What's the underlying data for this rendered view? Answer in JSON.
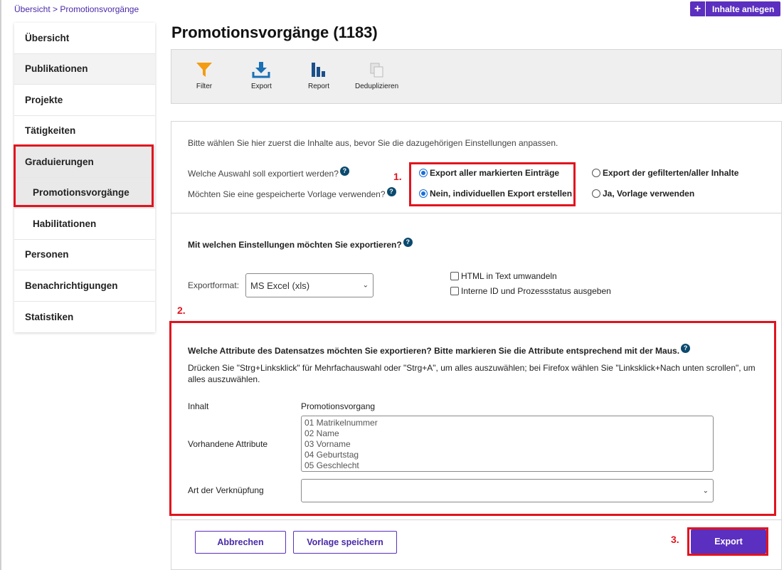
{
  "breadcrumb": {
    "home": "Übersicht",
    "separator": ">",
    "current": "Promotionsvorgänge"
  },
  "header": {
    "add_button_plus": "+",
    "add_button_label": "Inhalte anlegen"
  },
  "sidebar": {
    "items": [
      {
        "label": "Übersicht"
      },
      {
        "label": "Publikationen"
      },
      {
        "label": "Projekte"
      },
      {
        "label": "Tätigkeiten"
      },
      {
        "label": "Graduierungen"
      },
      {
        "label": "Promotionsvorgänge"
      },
      {
        "label": "Habilitationen"
      },
      {
        "label": "Personen"
      },
      {
        "label": "Benachrichtigungen"
      },
      {
        "label": "Statistiken"
      }
    ]
  },
  "page": {
    "title": "Promotionsvorgänge (1183)"
  },
  "toolbar": {
    "filter": "Filter",
    "export": "Export",
    "report": "Report",
    "dedup": "Deduplizieren"
  },
  "section1": {
    "intro": "Bitte wählen Sie hier zuerst die Inhalte aus, bevor Sie die dazugehörigen Einstellungen anpassen.",
    "q1": "Welche Auswahl soll exportiert werden?",
    "q2": "Möchten Sie eine gespeicherte Vorlage verwenden?",
    "opt_marked": "Export aller markierten Einträge",
    "opt_filtered": "Export der gefilterten/aller Inhalte",
    "opt_individual": "Nein, individuellen Export erstellen",
    "opt_template": "Ja, Vorlage verwenden",
    "step1": "1."
  },
  "section2": {
    "heading": "Mit welchen Einstellungen möchten Sie exportieren?",
    "format_label": "Exportformat:",
    "format_value": "MS Excel (xls)",
    "html_option": "HTML in Text umwandeln",
    "ids_option": "Interne ID und Prozessstatus ausgeben",
    "step2": "2."
  },
  "section3": {
    "heading": "Welche Attribute des Datensatzes möchten Sie exportieren? Bitte markieren Sie die Attribute entsprechend mit der Maus.",
    "hint": "Drücken Sie \"Strg+Linksklick\" für Mehrfachauswahl oder \"Strg+A\", um alles auszuwählen; bei Firefox wählen Sie \"Linksklick+Nach unten scrollen\", um alles auszuwählen.",
    "content_label": "Inhalt",
    "content_value": "Promotionsvorgang",
    "attributes_label": "Vorhandene Attribute",
    "attributes": [
      "01 Matrikelnummer",
      "02 Name",
      "03 Vorname",
      "04 Geburtstag",
      "05 Geschlecht"
    ],
    "link_label": "Art der Verknüpfung",
    "link_value": ""
  },
  "actions": {
    "cancel": "Abbrechen",
    "save_template": "Vorlage speichern",
    "export": "Export",
    "step3": "3."
  },
  "colors": {
    "accent": "#5b2fbf",
    "highlight": "#e1141e",
    "help": "#0b4a6e"
  },
  "help_icon_glyph": "?",
  "chevron_glyph": "⌄"
}
